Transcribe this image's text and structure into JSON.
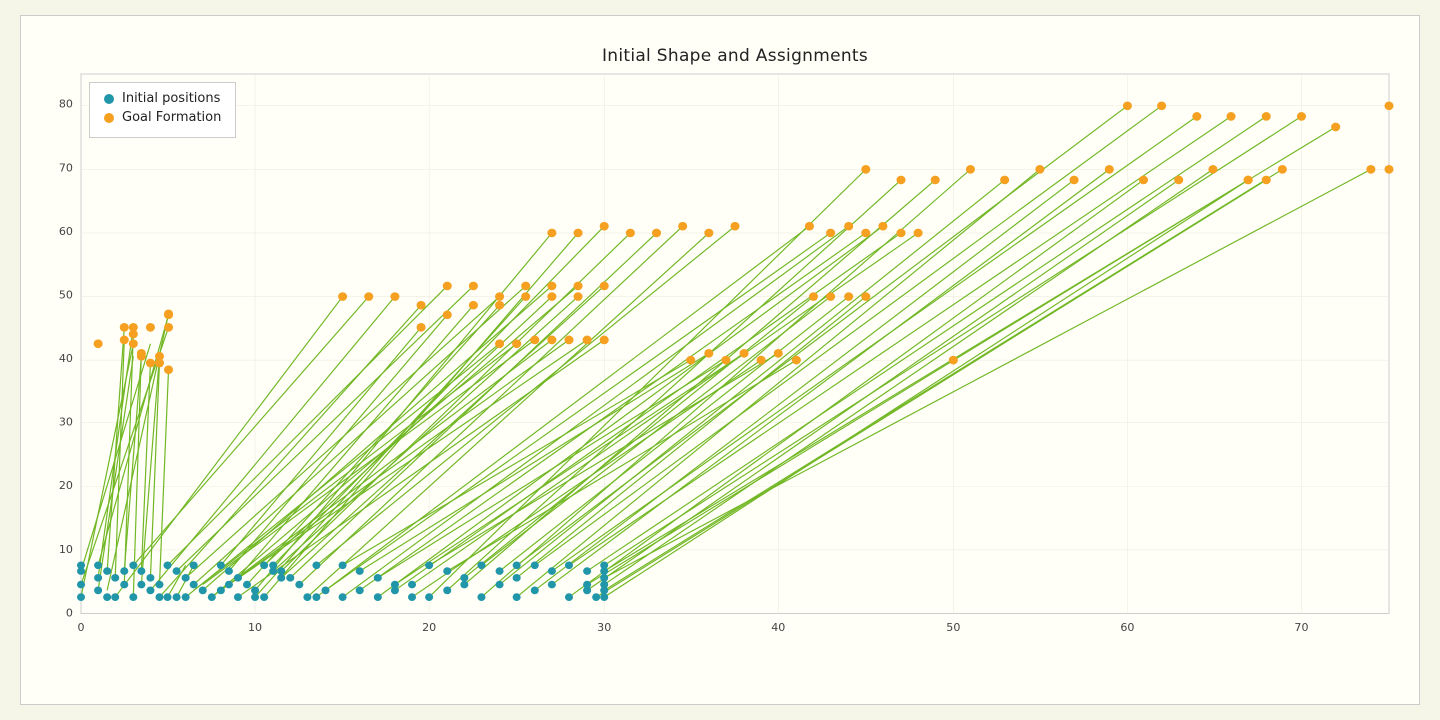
{
  "chart": {
    "title": "Initial Shape and Assignments",
    "background": "#fffff8",
    "xAxis": {
      "min": 0,
      "max": 75,
      "ticks": [
        0,
        10,
        20,
        30,
        40,
        50,
        60,
        70
      ]
    },
    "yAxis": {
      "min": 0,
      "max": 85,
      "ticks": [
        0,
        10,
        20,
        30,
        40,
        50,
        60,
        70,
        80
      ]
    },
    "legend": {
      "items": [
        {
          "label": "Initial positions",
          "color": "#1e8fa0"
        },
        {
          "label": "Goal Formation",
          "color": "#f5a623"
        }
      ]
    },
    "colors": {
      "initial": "#2196a8",
      "goal": "#f5a020",
      "line": "#5aab00"
    }
  }
}
